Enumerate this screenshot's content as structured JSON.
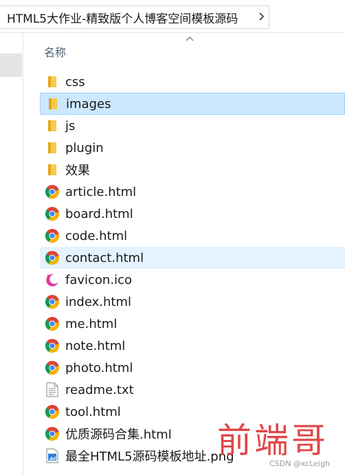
{
  "address_bar": {
    "path": "HTML5大作业-精致版个人博客空间模板源码"
  },
  "columns": {
    "name_label": "名称"
  },
  "files": [
    {
      "name": "css",
      "icon": "folder-icon",
      "state": "normal"
    },
    {
      "name": "images",
      "icon": "folder-icon",
      "state": "selected"
    },
    {
      "name": "js",
      "icon": "folder-icon",
      "state": "normal"
    },
    {
      "name": "plugin",
      "icon": "folder-icon",
      "state": "normal"
    },
    {
      "name": "效果",
      "icon": "folder-icon",
      "state": "normal"
    },
    {
      "name": "article.html",
      "icon": "chrome-icon",
      "state": "normal"
    },
    {
      "name": "board.html",
      "icon": "chrome-icon",
      "state": "normal"
    },
    {
      "name": "code.html",
      "icon": "chrome-icon",
      "state": "normal"
    },
    {
      "name": "contact.html",
      "icon": "chrome-icon",
      "state": "hover"
    },
    {
      "name": "favicon.ico",
      "icon": "crescent-icon",
      "state": "normal"
    },
    {
      "name": "index.html",
      "icon": "chrome-icon",
      "state": "normal"
    },
    {
      "name": "me.html",
      "icon": "chrome-icon",
      "state": "normal"
    },
    {
      "name": "note.html",
      "icon": "chrome-icon",
      "state": "normal"
    },
    {
      "name": "photo.html",
      "icon": "chrome-icon",
      "state": "normal"
    },
    {
      "name": "readme.txt",
      "icon": "text-file-icon",
      "state": "normal"
    },
    {
      "name": "tool.html",
      "icon": "chrome-icon",
      "state": "normal"
    },
    {
      "name": "优质源码合集.html",
      "icon": "chrome-icon",
      "state": "normal"
    },
    {
      "name": "最全HTML5源码模板地址.png",
      "icon": "image-file-icon",
      "state": "normal"
    }
  ],
  "watermark": {
    "text": "前端哥",
    "csdn": "CSDN @xcLeigh"
  },
  "colors": {
    "selected_bg": "#cce8ff",
    "selected_border": "#99d1ff",
    "hover_bg": "#e5f3ff",
    "folder": "#f8c94c",
    "watermark": "#e04848"
  }
}
